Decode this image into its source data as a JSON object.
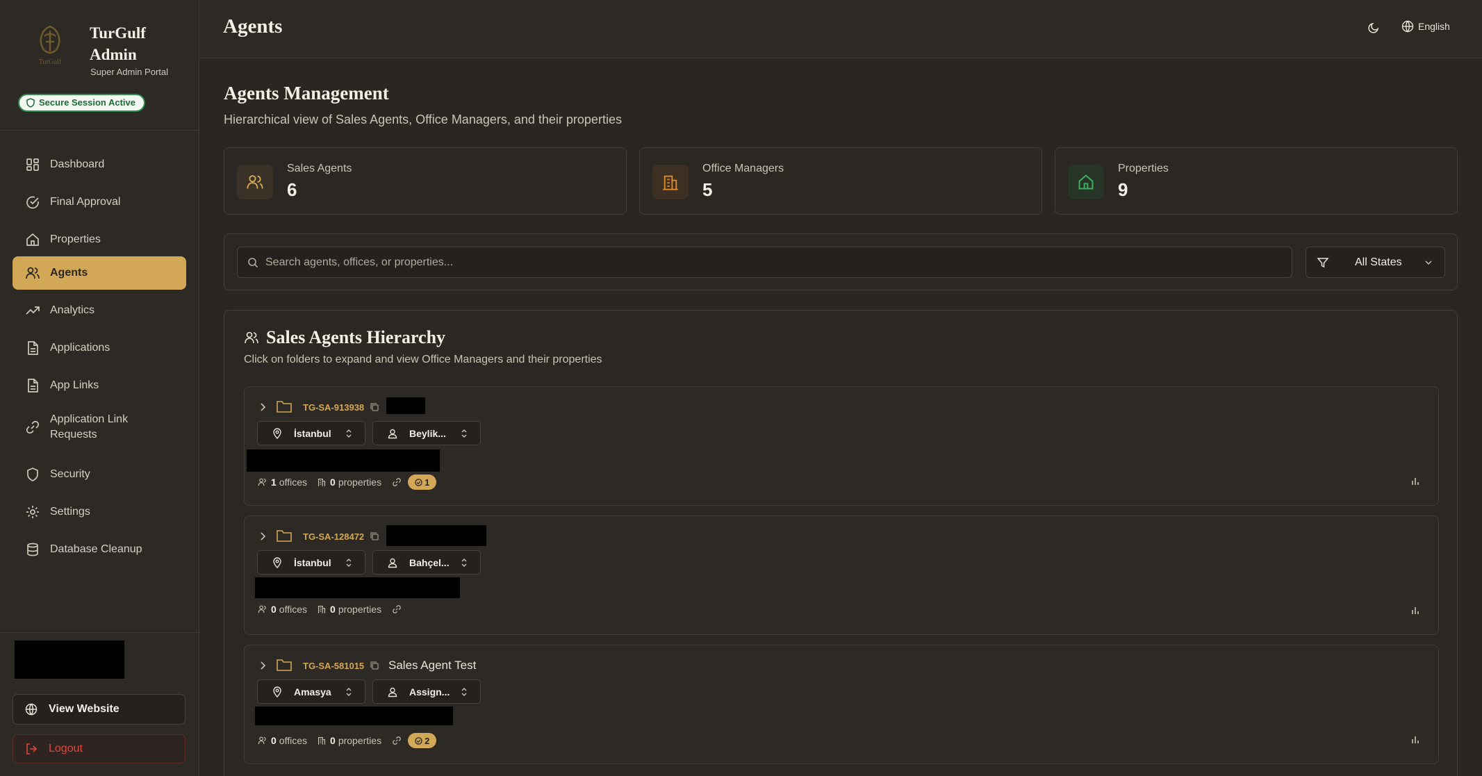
{
  "brand": {
    "title": "TurGulf Admin",
    "subtitle": "Super Admin Portal",
    "session_badge": "Secure Session Active"
  },
  "sidebar": {
    "items": [
      {
        "label": "Dashboard",
        "icon": "dashboard-icon"
      },
      {
        "label": "Final Approval",
        "icon": "check-circle-icon"
      },
      {
        "label": "Properties",
        "icon": "home-icon"
      },
      {
        "label": "Agents",
        "icon": "users-icon",
        "active": true
      },
      {
        "label": "Analytics",
        "icon": "trending-icon"
      },
      {
        "label": "Applications",
        "icon": "document-icon"
      },
      {
        "label": "App Links",
        "icon": "document-icon"
      },
      {
        "label": "Application Link Requests",
        "icon": "link-icon"
      },
      {
        "label": "Security",
        "icon": "shield-icon"
      },
      {
        "label": "Settings",
        "icon": "gear-icon"
      },
      {
        "label": "Database Cleanup",
        "icon": "database-icon"
      }
    ],
    "view_website": "View Website",
    "logout": "Logout"
  },
  "header": {
    "title": "Agents",
    "language": "English"
  },
  "main": {
    "title": "Agents Management",
    "subtitle": "Hierarchical view of Sales Agents, Office Managers, and their properties",
    "stats": [
      {
        "label": "Sales Agents",
        "value": "6"
      },
      {
        "label": "Office Managers",
        "value": "5"
      },
      {
        "label": "Properties",
        "value": "9"
      }
    ],
    "search_placeholder": "Search agents, offices, or properties...",
    "state_filter": "All States",
    "hierarchy": {
      "title": "Sales Agents Hierarchy",
      "subtitle": "Click on folders to expand and view Office Managers and their properties",
      "agents": [
        {
          "code": "TG-SA-913938",
          "name": "",
          "city": "İstanbul",
          "office": "Beylik...",
          "offices": "1",
          "offices_label": "offices",
          "properties": "0",
          "properties_label": "properties",
          "badge": "1"
        },
        {
          "code": "TG-SA-128472",
          "name": "",
          "city": "İstanbul",
          "office": "Bahçel...",
          "offices": "0",
          "offices_label": "offices",
          "properties": "0",
          "properties_label": "properties",
          "badge": ""
        },
        {
          "code": "TG-SA-581015",
          "name": "Sales Agent Test",
          "city": "Amasya",
          "office": "Assign...",
          "offices": "0",
          "offices_label": "offices",
          "properties": "0",
          "properties_label": "properties",
          "badge": "2"
        }
      ]
    }
  },
  "colors": {
    "accent": "#d2a857",
    "background": "#2a2622",
    "danger": "#dc4a3c",
    "success": "#2f8a4c"
  }
}
